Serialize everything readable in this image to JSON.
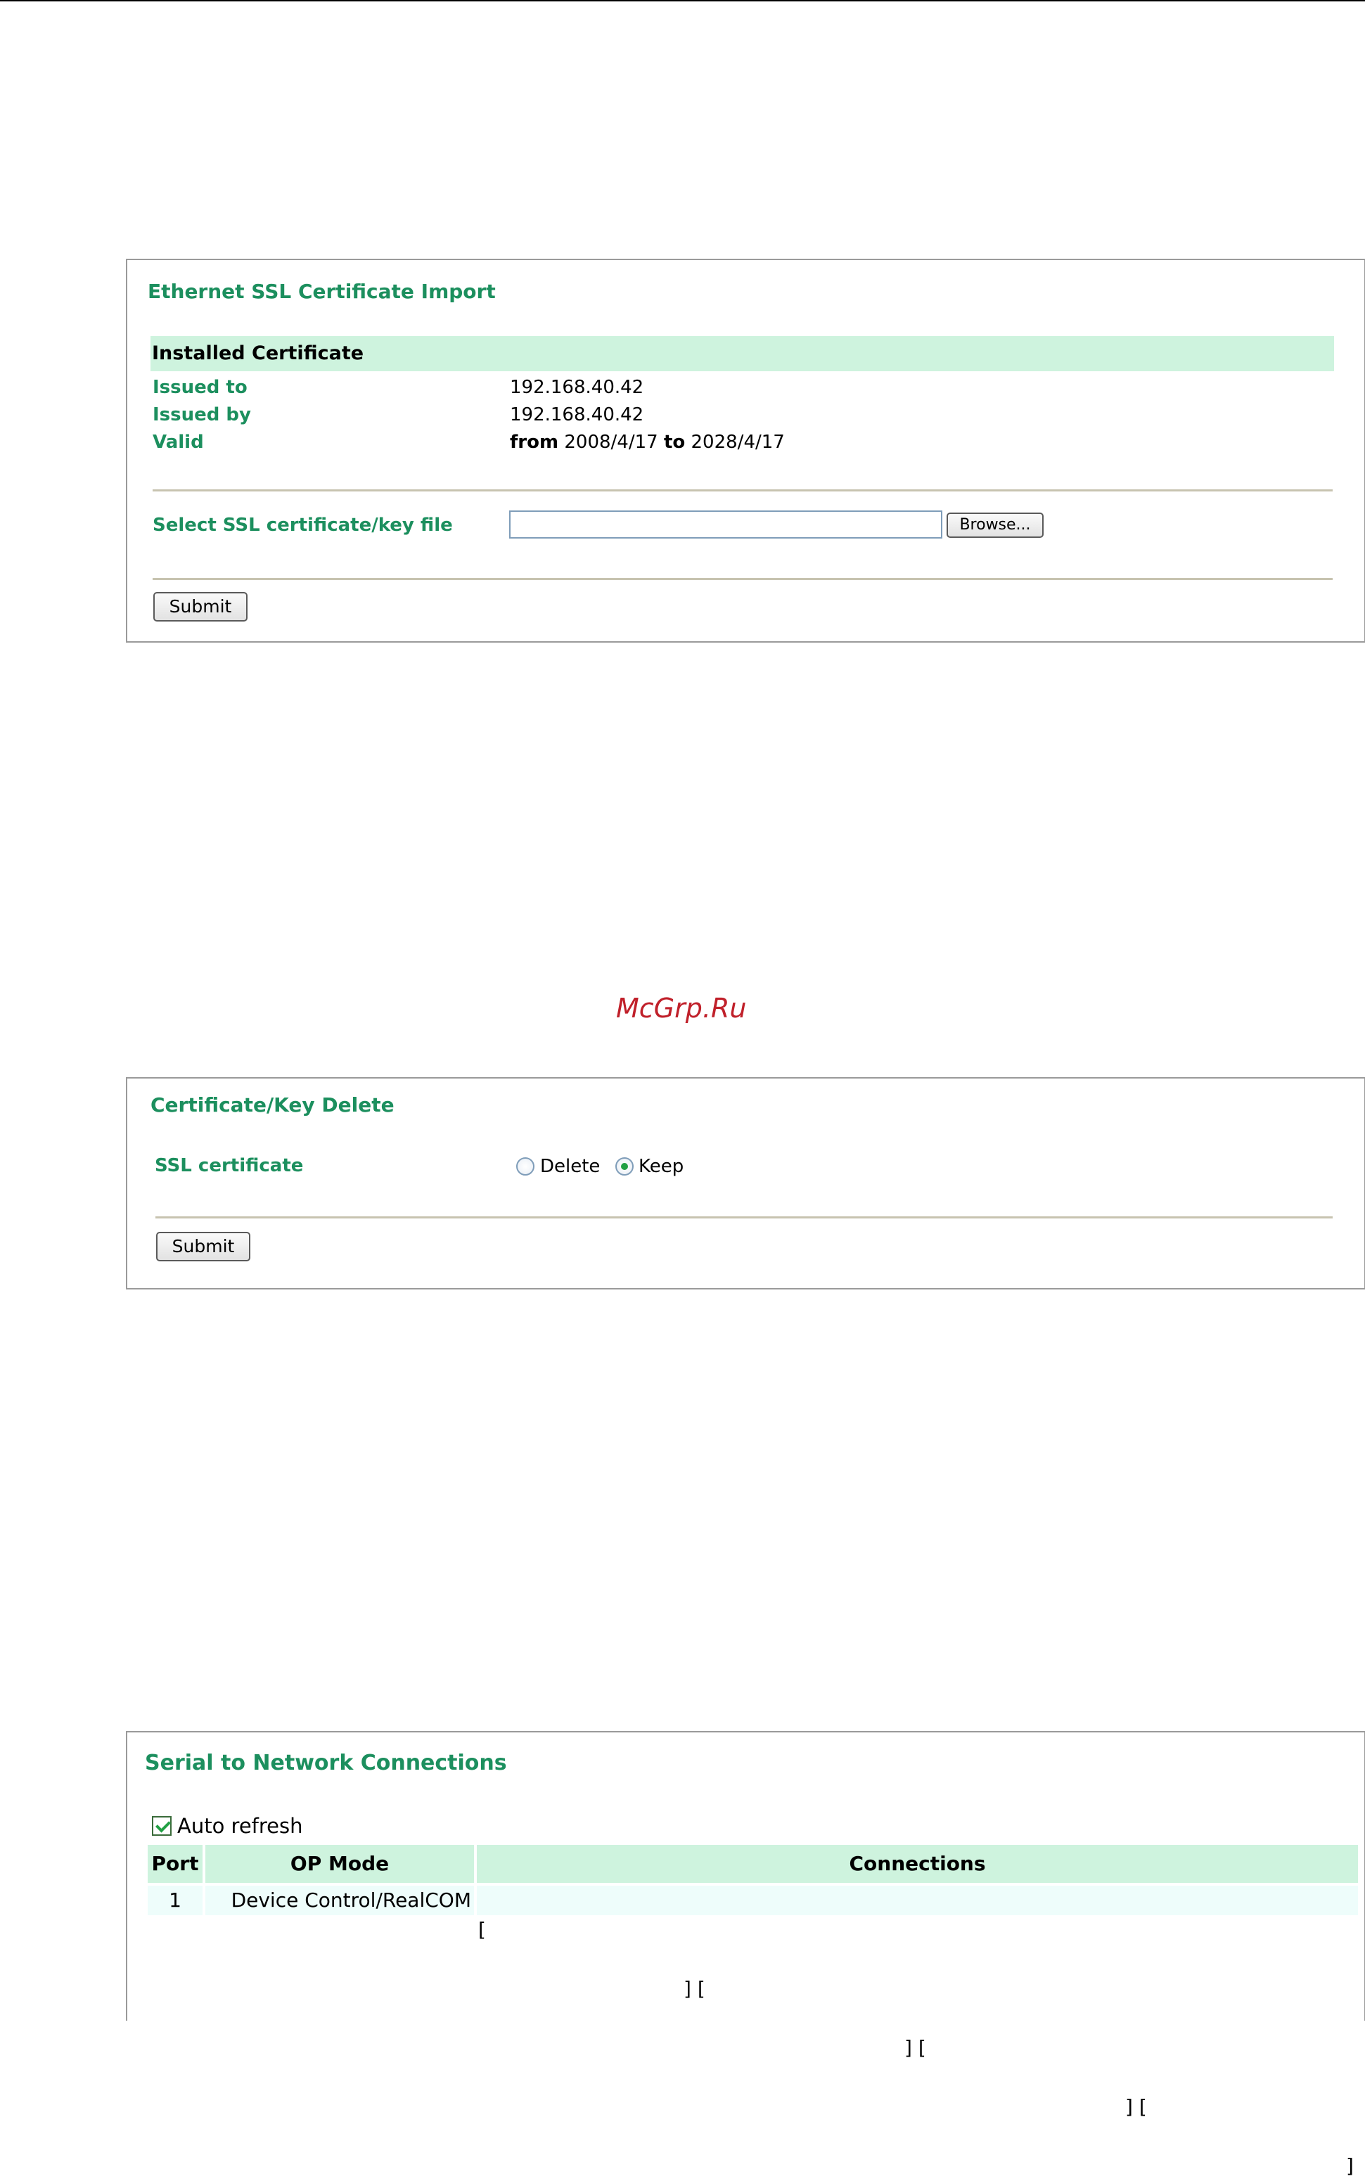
{
  "watermark": "McGrp.Ru",
  "ssl_import": {
    "title": "Ethernet SSL Certificate Import",
    "installed_header": "Installed Certificate",
    "issued_to_label": "Issued to",
    "issued_to_value": "192.168.40.42",
    "issued_by_label": "Issued by",
    "issued_by_value": "192.168.40.42",
    "valid_label": "Valid",
    "valid_from_word": "from",
    "valid_from_date": "2008/4/17",
    "valid_to_word": "to",
    "valid_to_date": "2028/4/17",
    "select_file_label": "Select SSL certificate/key file",
    "file_value": "",
    "browse_label": "Browse...",
    "submit_label": "Submit"
  },
  "cert_delete": {
    "title": "Certificate/Key Delete",
    "ssl_label": "SSL certificate",
    "options": [
      "Delete",
      "Keep"
    ],
    "selected": "Keep",
    "submit_label": "Submit"
  },
  "serial_connections": {
    "title": "Serial to Network Connections",
    "auto_refresh_label": "Auto refresh",
    "auto_refresh_checked": true,
    "columns": [
      "Port",
      "OP Mode",
      "Connections"
    ],
    "rows": [
      {
        "port": "1",
        "op_mode": "Device Control/RealCOM",
        "connections": [
          "",
          "",
          "",
          ""
        ]
      }
    ]
  }
}
